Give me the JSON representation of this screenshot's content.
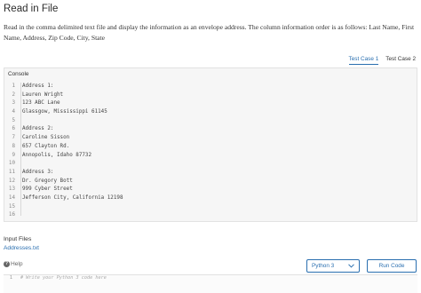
{
  "header": {
    "title": "Read in File",
    "description": "Read in the comma delimited text file and display the information as an envelope address. The column information order is as follows: Last Name, First Name, Address, Zip Code, City, State"
  },
  "tabs": [
    {
      "label": "Test Case 1",
      "active": true
    },
    {
      "label": "Test Case 2",
      "active": false
    }
  ],
  "console": {
    "label": "Console",
    "lines": [
      {
        "num": "1",
        "text": "Address 1:"
      },
      {
        "num": "2",
        "text": "Lauren Wright"
      },
      {
        "num": "3",
        "text": "123 ABC Lane"
      },
      {
        "num": "4",
        "text": "Glassgow, Mississippi 61145"
      },
      {
        "num": "5",
        "text": ""
      },
      {
        "num": "6",
        "text": "Address 2:"
      },
      {
        "num": "7",
        "text": "Caroline Sisson"
      },
      {
        "num": "8",
        "text": "657 Clayton Rd."
      },
      {
        "num": "9",
        "text": "Annopolis, Idaho 87732"
      },
      {
        "num": "10",
        "text": ""
      },
      {
        "num": "11",
        "text": "Address 3:"
      },
      {
        "num": "12",
        "text": "Dr. Gregory Bott"
      },
      {
        "num": "13",
        "text": "999 Cyber Street"
      },
      {
        "num": "14",
        "text": "Jefferson City, California 12198"
      },
      {
        "num": "15",
        "text": ""
      },
      {
        "num": "16",
        "text": ""
      }
    ]
  },
  "input_files": {
    "label": "Input Files",
    "file": "Addresses.txt"
  },
  "footer": {
    "help_label": "Help",
    "help_icon": "help-circle-icon",
    "language": "Python 3",
    "run_label": "Run Code"
  },
  "editor": {
    "line_num": "1",
    "placeholder": "# Write your Python 3 code here"
  },
  "colors": {
    "accent": "#2a6fb0",
    "console_bg": "#f6f6f6"
  }
}
